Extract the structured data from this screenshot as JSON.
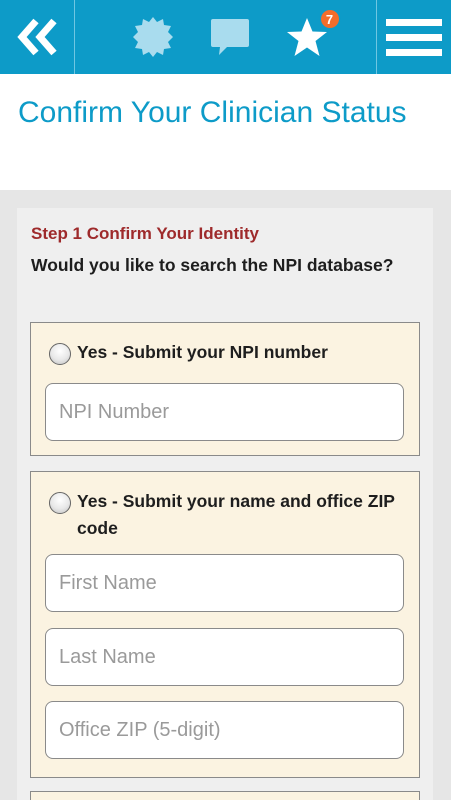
{
  "topbar": {
    "back_icon": "double-chevron-left-icon",
    "badge_icon": "certificate-icon",
    "chat_icon": "speech-bubble-icon",
    "star_icon": "star-icon",
    "star_badge_count": "7",
    "menu_icon": "hamburger-menu-icon",
    "colors": {
      "bar": "#0d9bc8",
      "badge": "#f36d2a"
    }
  },
  "page": {
    "title": "Confirm Your Clinician Status"
  },
  "form": {
    "step_title": "Step 1 Confirm Your Identity",
    "question": "Would you like to search the NPI database?",
    "option_npi": {
      "label": "Yes - Submit your NPI number",
      "npi_placeholder": "NPI Number"
    },
    "option_name_zip": {
      "label": "Yes - Submit your name and office ZIP code",
      "first_name_placeholder": "First Name",
      "last_name_placeholder": "Last Name",
      "zip_placeholder": "Office ZIP (5-digit)"
    }
  }
}
